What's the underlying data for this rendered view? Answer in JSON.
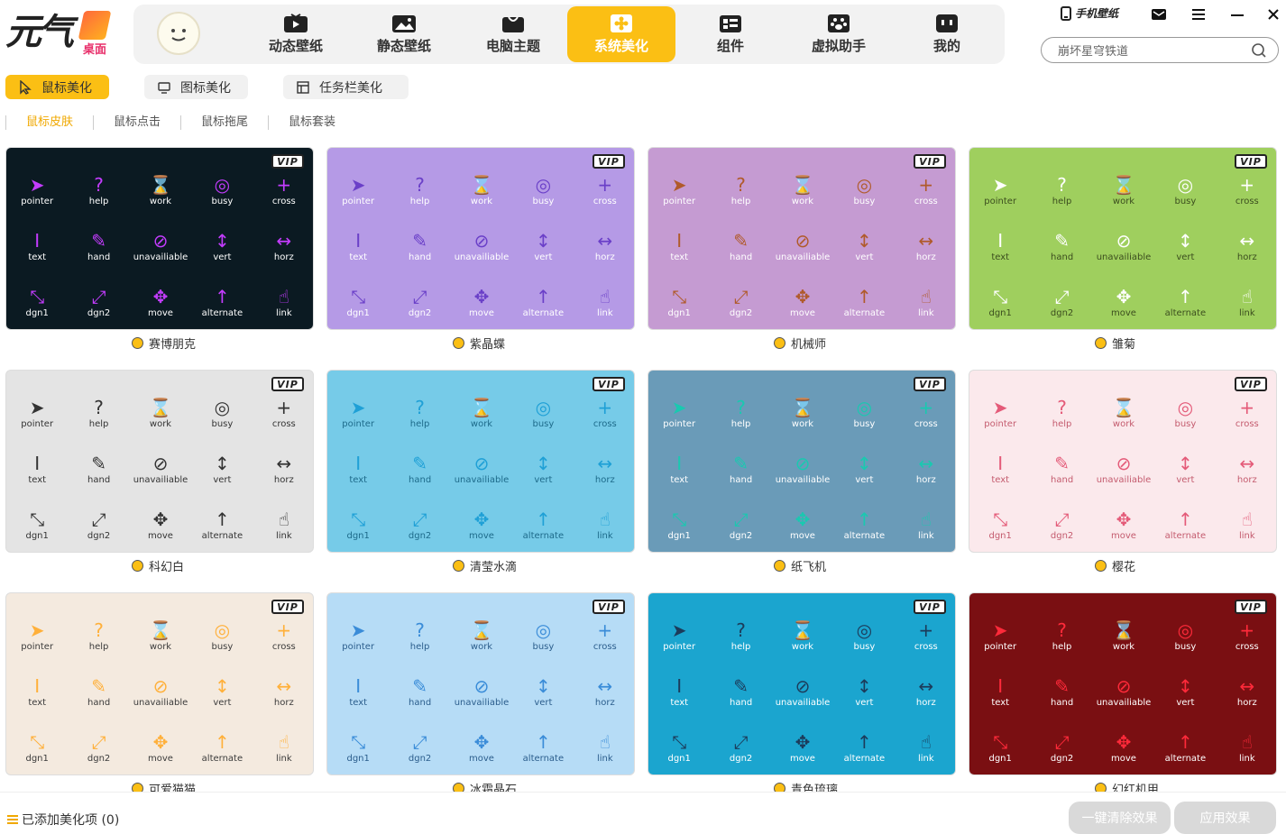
{
  "logo": {
    "text": "元气",
    "sub": "桌面"
  },
  "nav": [
    {
      "label": "动态壁纸",
      "icon": "tv-play-icon"
    },
    {
      "label": "静态壁纸",
      "icon": "image-icon"
    },
    {
      "label": "电脑主题",
      "icon": "theme-bag-icon"
    },
    {
      "label": "系统美化",
      "icon": "flower-icon",
      "active": true
    },
    {
      "label": "组件",
      "icon": "widget-icon"
    },
    {
      "label": "虚拟助手",
      "icon": "paw-icon"
    },
    {
      "label": "我的",
      "icon": "face-icon"
    }
  ],
  "topright": {
    "phone_wallpaper": "手机壁纸"
  },
  "search": {
    "placeholder": "崩坏星穹铁道"
  },
  "subtabs": [
    {
      "label": "鼠标美化",
      "active": true
    },
    {
      "label": "图标美化"
    },
    {
      "label": "任务栏美化"
    }
  ],
  "categories": [
    "鼠标皮肤",
    "鼠标点击",
    "鼠标拖尾",
    "鼠标套装"
  ],
  "cursor_labels": [
    "pointer",
    "help",
    "work",
    "busy",
    "cross",
    "text",
    "hand",
    "unavailiable",
    "vert",
    "horz",
    "dgn1",
    "dgn2",
    "move",
    "alternate",
    "link"
  ],
  "cards": [
    {
      "name": "赛博朋克",
      "bg": "#0b1a22",
      "fg": "#ffffff",
      "accent": "#c43cff"
    },
    {
      "name": "紫晶蝶",
      "bg": "#b59ae6",
      "fg": "#ffffff",
      "accent": "#6a3fc8"
    },
    {
      "name": "机械师",
      "bg": "#c59bd2",
      "fg": "#ffffff",
      "accent": "#b05a2a"
    },
    {
      "name": "雏菊",
      "bg": "#9fcf5e",
      "fg": "#3b4d1e",
      "accent": "#ffffff"
    },
    {
      "name": "科幻白",
      "bg": "#e4e4e4",
      "fg": "#333333",
      "accent": "#333333"
    },
    {
      "name": "清莹水滴",
      "bg": "#76cbe8",
      "fg": "#1d6a8a",
      "accent": "#1fa0d6"
    },
    {
      "name": "纸飞机",
      "bg": "#6a9bb8",
      "fg": "#ffffff",
      "accent": "#19c9b0"
    },
    {
      "name": "樱花",
      "bg": "#fbe9ec",
      "fg": "#c45b6e",
      "accent": "#e45a78"
    },
    {
      "name": "可爱猫猫",
      "bg": "#f4eadf",
      "fg": "#3b3b3b",
      "accent": "#ffb03a"
    },
    {
      "name": "冰霜晶石",
      "bg": "#b6dcf6",
      "fg": "#2b5d8c",
      "accent": "#3a8cd8"
    },
    {
      "name": "青色琉璃",
      "bg": "#1ba5cf",
      "fg": "#ffffff",
      "accent": "#1c3b5a"
    },
    {
      "name": "幻红机甲",
      "bg": "#7a0f12",
      "fg": "#ffffff",
      "accent": "#ff2a3a"
    }
  ],
  "vip_label": "VIP",
  "bottom": {
    "added": "已添加美化项 (0)",
    "clear_label": "一键清除效果",
    "apply_label": "应用效果"
  },
  "colors": {
    "accent": "#fbbf14"
  }
}
